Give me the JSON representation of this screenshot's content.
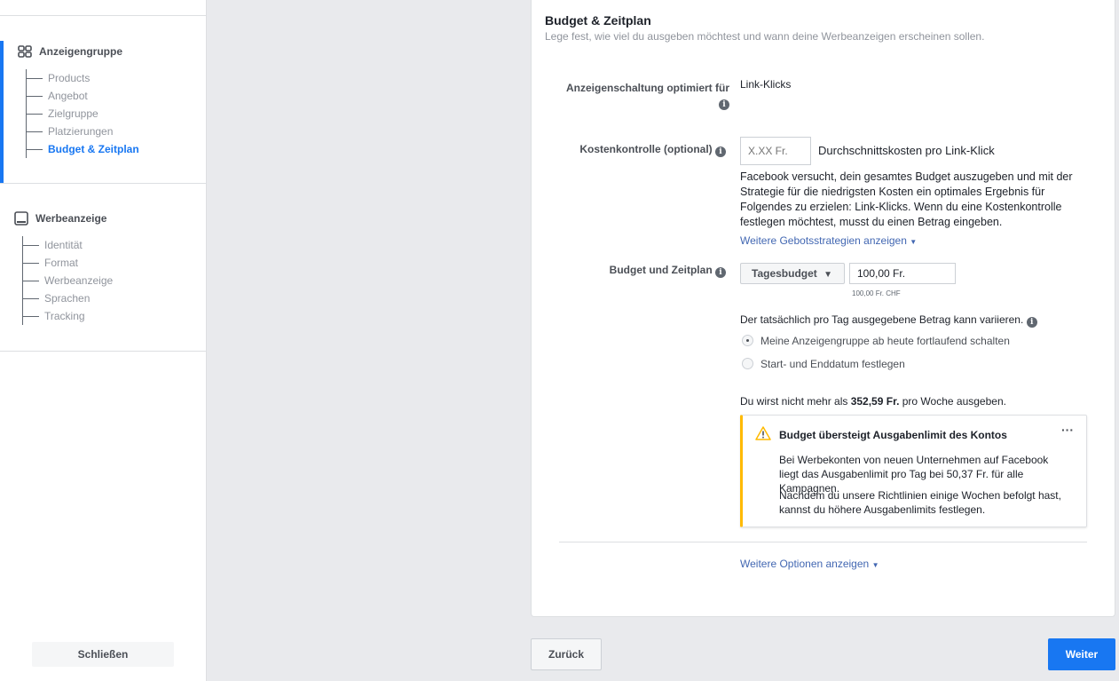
{
  "sidebar": {
    "group1": {
      "title": "Anzeigengruppe",
      "icon": "grid-icon",
      "items": [
        {
          "label": "Products"
        },
        {
          "label": "Angebot"
        },
        {
          "label": "Zielgruppe"
        },
        {
          "label": "Platzierungen"
        },
        {
          "label": "Budget & Zeitplan",
          "active": true
        }
      ]
    },
    "group2": {
      "title": "Werbeanzeige",
      "icon": "ad-preview-icon",
      "items": [
        {
          "label": "Identität"
        },
        {
          "label": "Format"
        },
        {
          "label": "Werbeanzeige"
        },
        {
          "label": "Sprachen"
        },
        {
          "label": "Tracking"
        }
      ]
    },
    "close_label": "Schließen"
  },
  "main": {
    "title": "Budget & Zeitplan",
    "subtitle": "Lege fest, wie viel du ausgeben möchtest und wann deine Werbeanzeigen erscheinen sollen.",
    "optimize": {
      "label": "Anzeigenschaltung optimiert für",
      "value": "Link-Klicks"
    },
    "cost": {
      "label": "Kostenkontrolle (optional)",
      "placeholder": "X.XX Fr.",
      "suffix": "Durchschnittskosten pro Link-Klick",
      "description": "Facebook versucht, dein gesamtes Budget auszugeben und mit der Strategie für die niedrigsten Kosten ein optimales Ergebnis für Folgendes zu erzielen: Link-Klicks. Wenn du eine Kostenkontrolle festlegen möchtest, musst du einen Betrag eingeben.",
      "more_link": "Weitere Gebotsstrategien anzeigen"
    },
    "budget": {
      "label": "Budget und Zeitplan",
      "type": "Tagesbudget",
      "amount": "100,00 Fr.",
      "amount_note": "100,00 Fr. CHF",
      "variance": "Der tatsächlich pro Tag ausgegebene Betrag kann variieren.",
      "radio1": "Meine Anzeigengruppe ab heute fortlaufend schalten",
      "radio2": "Start- und Enddatum festlegen",
      "selected": 1,
      "weekly_pre": "Du wirst nicht mehr als ",
      "weekly_amount": "352,59 Fr.",
      "weekly_post": " pro Woche ausgeben."
    },
    "warning": {
      "title": "Budget übersteigt Ausgabenlimit des Kontos",
      "p1": "Bei Werbekonten von neuen Unternehmen auf Facebook liegt das Ausgabenlimit pro Tag bei 50,37 Fr. für alle Kampagnen.",
      "p2": "Nachdem du unsere Richtlinien einige Wochen befolgt hast, kannst du höhere Ausgabenlimits festlegen.",
      "accent": "#ffba00"
    },
    "more_options": "Weitere Optionen anzeigen"
  },
  "footer": {
    "back": "Zurück",
    "next": "Weiter",
    "next_color": "#1877f2"
  }
}
